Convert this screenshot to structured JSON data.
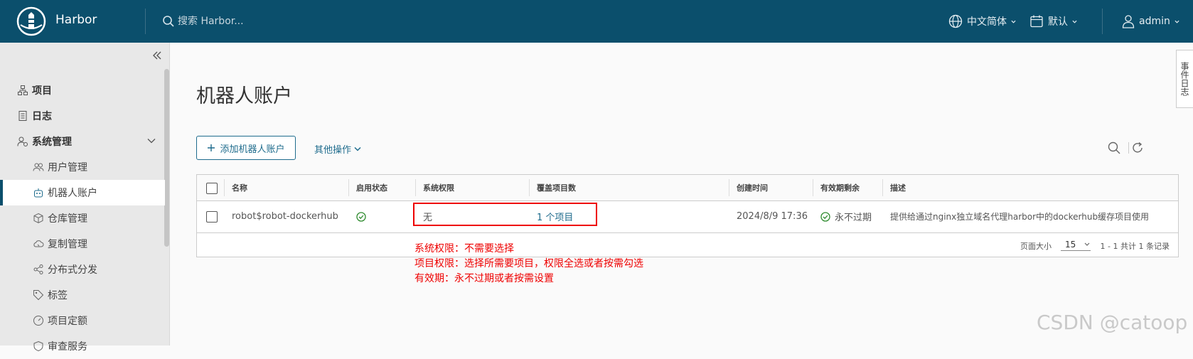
{
  "header": {
    "app_title": "Harbor",
    "search_placeholder": "搜索 Harbor...",
    "language": "中文简体",
    "theme": "默认",
    "user": "admin"
  },
  "sidebar": {
    "items": [
      {
        "label": "项目",
        "icon": "projects-icon"
      },
      {
        "label": "日志",
        "icon": "log-icon"
      },
      {
        "label": "系统管理",
        "icon": "admin-icon"
      },
      {
        "label": "用户管理",
        "icon": "users-icon"
      },
      {
        "label": "机器人账户",
        "icon": "robot-icon",
        "active": true
      },
      {
        "label": "仓库管理",
        "icon": "registry-icon"
      },
      {
        "label": "复制管理",
        "icon": "replication-icon"
      },
      {
        "label": "分布式分发",
        "icon": "share-icon"
      },
      {
        "label": "标签",
        "icon": "tag-icon"
      },
      {
        "label": "项目定额",
        "icon": "quota-icon"
      },
      {
        "label": "审查服务",
        "icon": "scanner-icon"
      }
    ]
  },
  "main": {
    "title": "机器人账户",
    "add_button": "添加机器人账户",
    "other_ops": "其他操作",
    "table": {
      "columns": [
        "名称",
        "启用状态",
        "系统权限",
        "覆盖项目数",
        "创建时间",
        "有效期剩余",
        "描述"
      ],
      "rows": [
        {
          "name": "robot$robot-dockerhub",
          "enabled": true,
          "system_perm": "无",
          "projects": "1 个项目",
          "created": "2024/8/9 17:36",
          "expiry": "永不过期",
          "description": "提供给通过nginx独立域名代理harbor中的dockerhub缓存项目使用"
        }
      ],
      "page_size_label": "页面大小",
      "page_size": "15",
      "total": "1 - 1 共计 1 条记录"
    }
  },
  "annotations": [
    "系统权限：不需要选择",
    "项目权限：选择所需要项目，权限全选或者按需勾选",
    "有效期：永不过期或者按需设置"
  ],
  "side_tab": "事件日志",
  "watermark": "CSDN @catoop",
  "colors": {
    "header": "#0b4f6c",
    "accent": "#1f6c8d",
    "annotation": "#e00000",
    "success": "#2e8b2e"
  }
}
